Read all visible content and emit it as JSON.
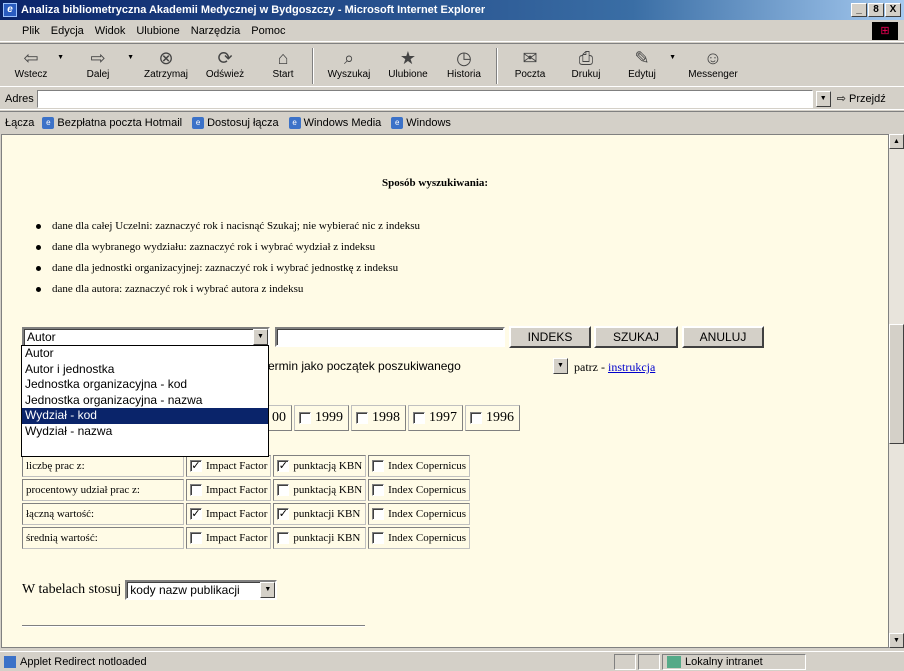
{
  "window": {
    "title": "Analiza bibliometryczna Akademii Medycznej w Bydgoszczy - Microsoft Internet Explorer",
    "buttons": [
      "_",
      "8",
      "X"
    ]
  },
  "menubar": {
    "items": [
      "Plik",
      "Edycja",
      "Widok",
      "Ulubione",
      "Narzędzia",
      "Pomoc"
    ]
  },
  "toolbar": {
    "buttons": [
      {
        "label": "Wstecz",
        "icon": "back-arrow-icon",
        "glyph": "⇦"
      },
      {
        "label": "Dalej",
        "icon": "forward-arrow-icon",
        "glyph": "⇨"
      },
      {
        "label": "Zatrzymaj",
        "icon": "stop-icon",
        "glyph": "⊗"
      },
      {
        "label": "Odśwież",
        "icon": "refresh-icon",
        "glyph": "⟳"
      },
      {
        "label": "Start",
        "icon": "home-icon",
        "glyph": "⌂"
      },
      {
        "label": "Wyszukaj",
        "icon": "search-icon",
        "glyph": "⌕"
      },
      {
        "label": "Ulubione",
        "icon": "favorites-icon",
        "glyph": "★"
      },
      {
        "label": "Historia",
        "icon": "history-icon",
        "glyph": "◷"
      },
      {
        "label": "Poczta",
        "icon": "mail-icon",
        "glyph": "✉"
      },
      {
        "label": "Drukuj",
        "icon": "print-icon",
        "glyph": "⎙"
      },
      {
        "label": "Edytuj",
        "icon": "edit-icon",
        "glyph": "✎"
      },
      {
        "label": "Messenger",
        "icon": "messenger-icon",
        "glyph": "☺"
      }
    ]
  },
  "address": {
    "label": "Adres",
    "value": "",
    "go_label": "Przejdź"
  },
  "links": {
    "label": "Łącza",
    "items": [
      "Bezpłatna poczta Hotmail",
      "Dostosuj łącza",
      "Windows Media",
      "Windows"
    ]
  },
  "page": {
    "heading": "Sposób wyszukiwania:",
    "bullets": [
      "dane dla całej Uczelni: zaznaczyć rok i nacisnąć Szukaj; nie wybierać nic z indeksu",
      "dane dla wybranego wydziału: zaznaczyć rok i wybrać wydział z indeksu",
      "dane dla jednostki organizacyjnej: zaznaczyć rok i wybrać jednostkę z indeksu",
      "dane dla autora: zaznaczyć rok i wybrać autora z indeksu"
    ],
    "search_type": {
      "selected": "Autor",
      "options": [
        "Autor",
        "Autor i jednostka",
        "Jednostka organizacyjna - kod",
        "Jednostka organizacyjna - nazwa",
        "Wydział - kod",
        "Wydział - nazwa"
      ],
      "highlighted_index": 4
    },
    "search_input": "",
    "buttons": {
      "index": "INDEKS",
      "search": "SZUKAJ",
      "cancel": "ANULUJ"
    },
    "term_mode_tail": "ermin jako początek poszukiwanego",
    "see_label": "patrz -",
    "instruction_link": "instrukcja",
    "years": [
      {
        "label": "00",
        "checked": false
      },
      {
        "label": "1999",
        "checked": false
      },
      {
        "label": "1998",
        "checked": false
      },
      {
        "label": "1997",
        "checked": false
      },
      {
        "label": "1996",
        "checked": false
      }
    ],
    "options_table": [
      {
        "label": "liczbę prac z:",
        "cells": [
          {
            "text": "Impact Factor",
            "checked": true
          },
          {
            "text": "punktacją KBN",
            "checked": true
          },
          {
            "text": "Index Copernicus",
            "checked": false
          }
        ]
      },
      {
        "label": "procentowy udział prac z:",
        "cells": [
          {
            "text": "Impact Factor",
            "checked": false
          },
          {
            "text": "punktacją KBN",
            "checked": false
          },
          {
            "text": "Index Copernicus",
            "checked": false
          }
        ]
      },
      {
        "label": "łączną wartość:",
        "cells": [
          {
            "text": "Impact Factor",
            "checked": true
          },
          {
            "text": "punktacji KBN",
            "checked": true
          },
          {
            "text": "Index Copernicus",
            "checked": false
          }
        ]
      },
      {
        "label": "średnią wartość:",
        "cells": [
          {
            "text": "Impact Factor",
            "checked": false
          },
          {
            "text": "punktacji KBN",
            "checked": false
          },
          {
            "text": "Index Copernicus",
            "checked": false
          }
        ]
      }
    ],
    "tables_label": "W tabelach stosuj",
    "tables_select": "kody nazw publikacji"
  },
  "status": {
    "text": "Applet Redirect notloaded",
    "zone": "Lokalny intranet"
  },
  "colors": {
    "title_gradient_start": "#0a246a",
    "page_background": "#fffbe6",
    "selection": "#0a246a",
    "link": "#0000cc"
  }
}
